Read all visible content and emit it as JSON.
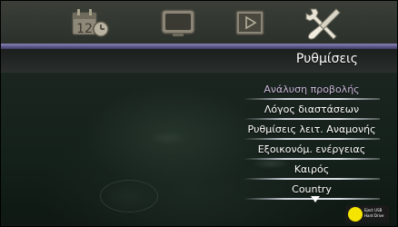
{
  "topbar": {
    "icons": [
      "calendar-12-icon",
      "tv-icon",
      "media-play-icon",
      "settings-tools-icon"
    ]
  },
  "page": {
    "title": "Ρυθμίσεις"
  },
  "menu": {
    "items": [
      {
        "label": "Ανάλυση προβολής",
        "selected": true
      },
      {
        "label": "Λόγος διαστάσεων",
        "selected": false
      },
      {
        "label": "Ρυθμίσεις λειτ. Αναμονής",
        "selected": false
      },
      {
        "label": "Εξοικονόμ. ενέργειας",
        "selected": false
      },
      {
        "label": "Καιρός",
        "selected": false
      },
      {
        "label": "Country",
        "selected": false
      }
    ]
  },
  "calendar_icon": {
    "day": "12"
  },
  "eject_button": {
    "label_line1": "Eject USB",
    "label_line2": "Hard Drive"
  },
  "colors": {
    "accent_line": "#7a76a8",
    "selected_text": "#c9b8d8",
    "eject_dot": "#f5e400"
  }
}
